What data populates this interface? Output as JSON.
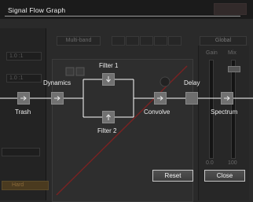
{
  "window": {
    "title": "Signal Flow Graph"
  },
  "background": {
    "left_fields": [
      "1.0 :1",
      "1.0 :1"
    ],
    "multiband_label": "Multi-band",
    "global_label": "Global",
    "gain_label": "Gain",
    "mix_label": "Mix",
    "hard_label": "Hard",
    "value_a": "0.0",
    "value_b": "100"
  },
  "nodes": {
    "dynamics": "Dynamics",
    "trash": "Trash",
    "filter1": "Filter 1",
    "filter2": "Filter 2",
    "convolve": "Convolve",
    "delay": "Delay",
    "spectrum": "Spectrum"
  },
  "buttons": {
    "reset": "Reset",
    "close": "Close"
  },
  "colors": {
    "node_fill": "#717171",
    "wire": "#ffffff",
    "accent_diag": "#7a2222"
  }
}
